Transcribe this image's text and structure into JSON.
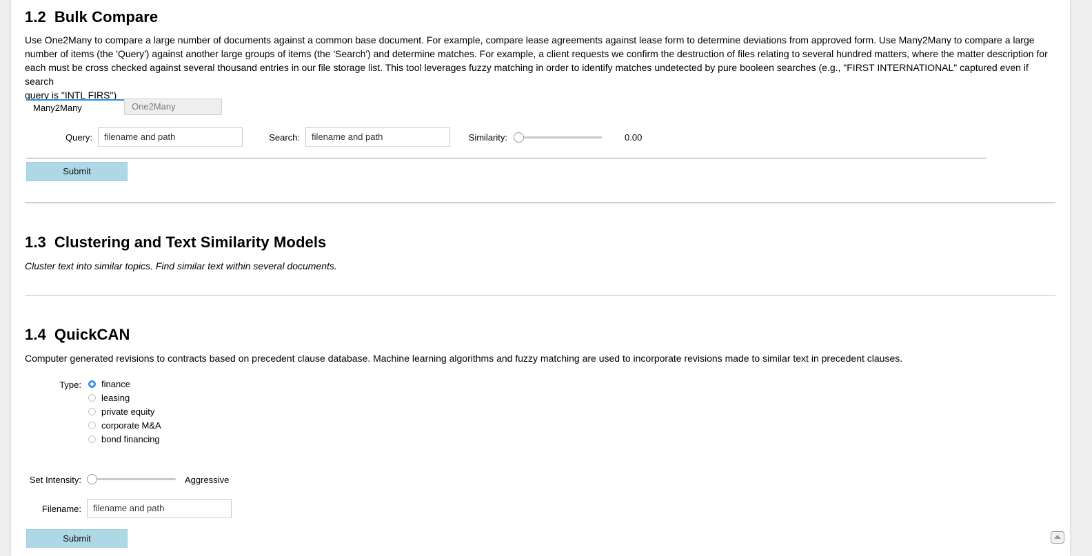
{
  "bulk_compare": {
    "number": "1.2",
    "title": "Bulk Compare",
    "description_lines": [
      "Use One2Many to compare a large number of documents against a common base document. For example, compare lease agreements against lease form to determine deviations from approved form. Use Many2Many to compare a large",
      "number of items (the 'Query') against another large groups of items (the 'Search') and determine matches. For example, a client requests we confirm the destruction of files relating to several hundred matters, where the matter description for",
      "each must be cross checked against several thousand entries in our file storage list. This tool leverages fuzzy matching in order to identify matches undetected by pure booleen searches (e.g., \"FIRST INTERNATIONAL\" captured even if search",
      "query is \"INTL FIRS\")"
    ],
    "tabs": [
      {
        "label": "Many2Many",
        "active": true
      },
      {
        "label": "One2Many",
        "active": false
      }
    ],
    "query_label": "Query:",
    "query_placeholder": "filename and path",
    "search_label": "Search:",
    "search_placeholder": "filename and path",
    "similarity_label": "Similarity:",
    "similarity_value": "0.00",
    "similarity_level": 0,
    "submit_label": "Submit"
  },
  "clustering": {
    "number": "1.3",
    "title": "Clustering and Text Similarity Models",
    "description": "Cluster text into similar topics. Find similar text within several documents."
  },
  "quickcan": {
    "number": "1.4",
    "title": "QuickCAN",
    "description": "Computer generated revisions to contracts based on precedent clause database. Machine learning algorithms and fuzzy matching are used to incorporate revisions made to similar text in precedent clauses.",
    "type_label": "Type:",
    "type_options": [
      {
        "label": "finance",
        "checked": true
      },
      {
        "label": "leasing",
        "checked": false
      },
      {
        "label": "private equity",
        "checked": false
      },
      {
        "label": "corporate M&A",
        "checked": false
      },
      {
        "label": "bond financing",
        "checked": false
      }
    ],
    "intensity_label": "Set Intensity:",
    "intensity_value": "Aggressive",
    "intensity_level": 0,
    "filename_label": "Filename:",
    "filename_placeholder": "filename and path",
    "submit_label": "Submit"
  },
  "colors": {
    "accent": "#2b8be0",
    "button": "#aed8e6",
    "radio_checked": "#3b91e6"
  },
  "icons": {
    "scroll_top": "scroll-to-top-icon"
  }
}
